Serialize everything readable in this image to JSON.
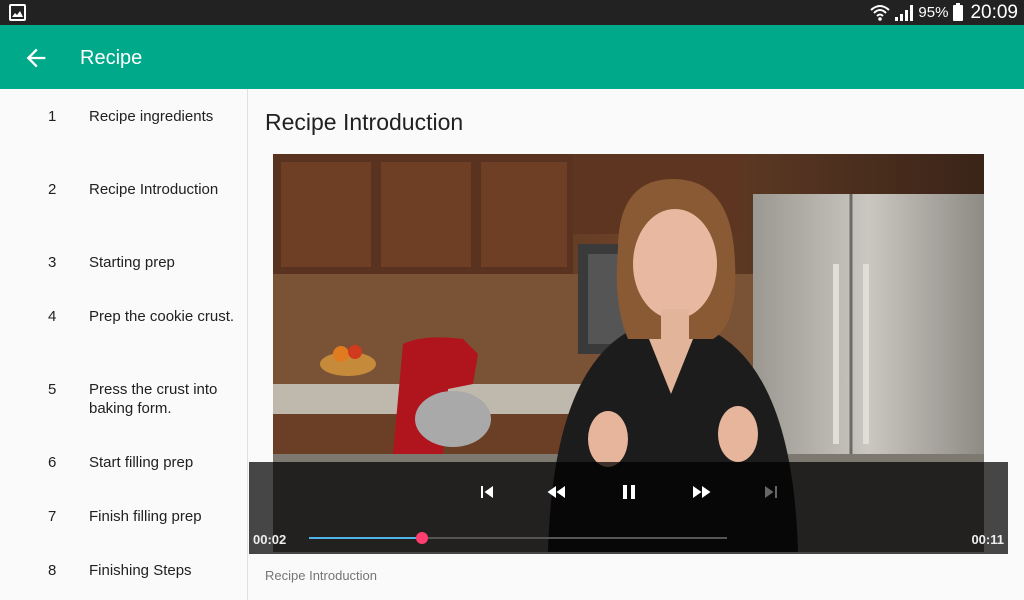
{
  "status_bar": {
    "battery": "95%",
    "time": "20:09",
    "icons": [
      "gallery-icon",
      "wifi-icon",
      "signal-icon",
      "battery-icon"
    ]
  },
  "app_bar": {
    "title": "Recipe",
    "back_icon": "arrow-back-icon",
    "color": "#00a98a"
  },
  "steps": [
    {
      "number": "1",
      "label": "Recipe ingredients"
    },
    {
      "number": "2",
      "label": "Recipe Introduction"
    },
    {
      "number": "3",
      "label": "Starting prep"
    },
    {
      "number": "4",
      "label": "Prep the cookie crust."
    },
    {
      "number": "5",
      "label": "Press the crust into baking form."
    },
    {
      "number": "6",
      "label": "Start filling prep"
    },
    {
      "number": "7",
      "label": "Finish filling prep"
    },
    {
      "number": "8",
      "label": "Finishing Steps"
    }
  ],
  "main": {
    "title": "Recipe Introduction",
    "caption": "Recipe Introduction"
  },
  "player": {
    "current_time": "00:02",
    "duration": "00:11",
    "progress": 0.27,
    "controls": [
      "skip-previous-icon",
      "rewind-icon",
      "pause-icon",
      "fast-forward-icon",
      "skip-next-icon"
    ],
    "progress_color": "#4fb3e8",
    "thumb_color": "#ff3d6e"
  }
}
